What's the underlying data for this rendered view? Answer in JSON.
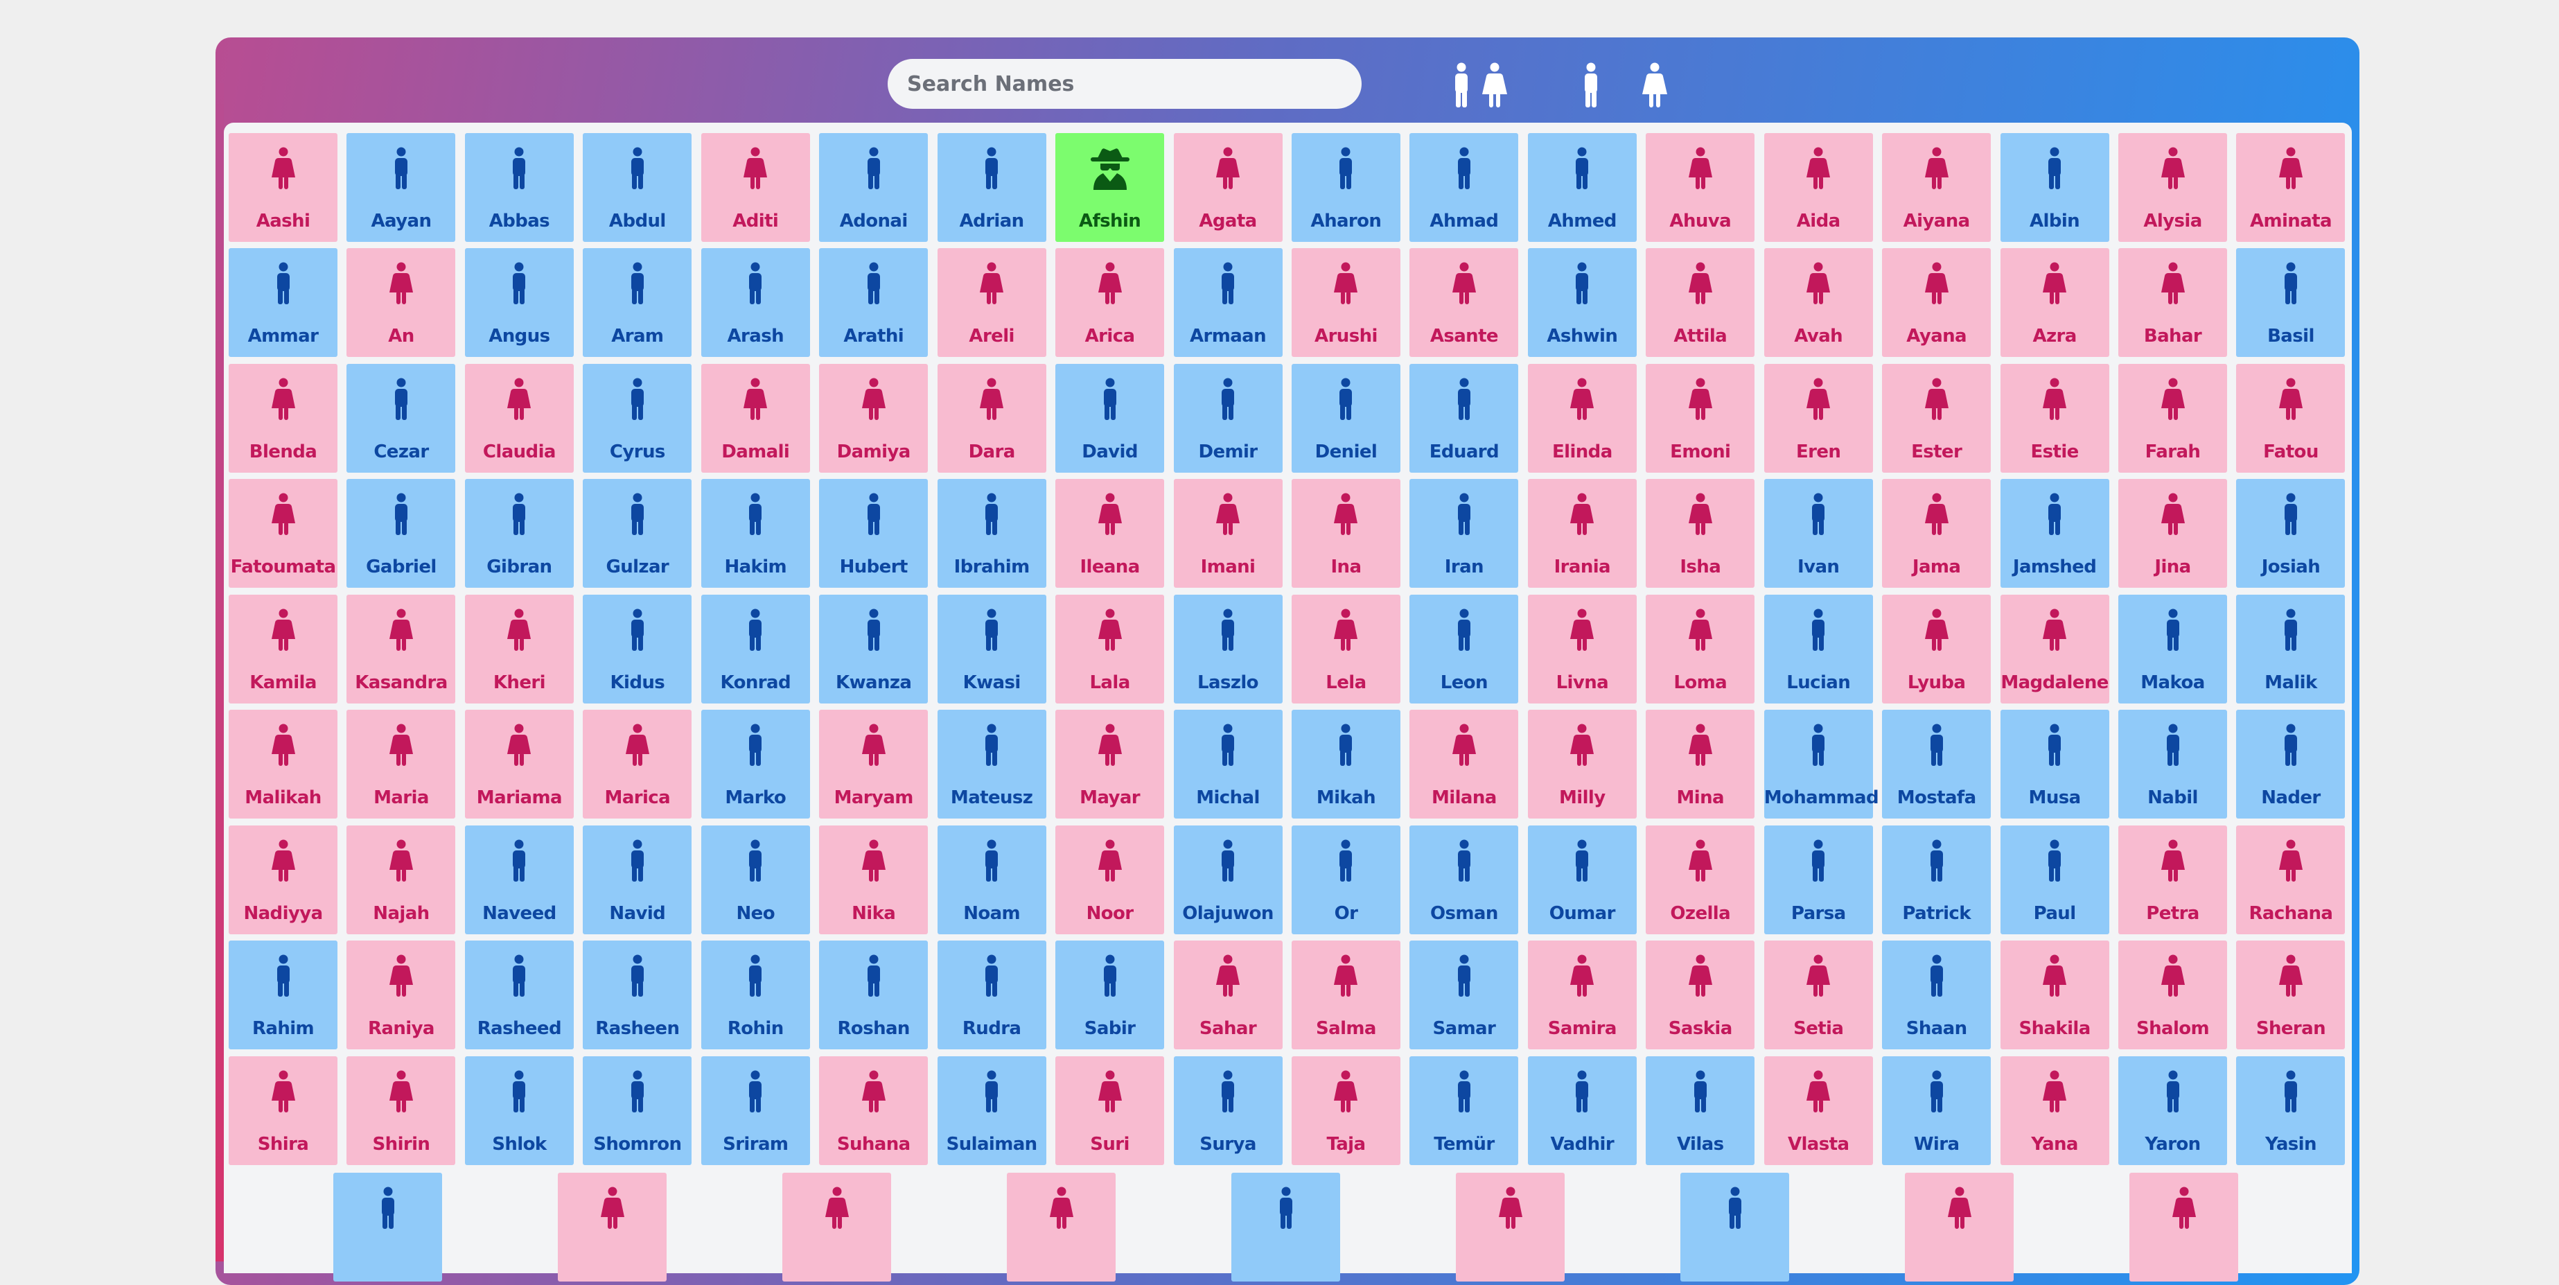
{
  "search": {
    "placeholder": "Search Names",
    "value": ""
  },
  "filters": [
    {
      "name": "filter-all-button",
      "icon": "man-and-woman-icon"
    },
    {
      "name": "filter-boys-button",
      "icon": "man-icon"
    },
    {
      "name": "filter-girls-button",
      "icon": "woman-icon"
    }
  ],
  "colors": {
    "boy_bg": "#90caf9",
    "boy_fg": "#0d47a1",
    "girl_bg": "#f8bbd0",
    "girl_fg": "#c2185b",
    "selected_bg": "#7cfc6e",
    "selected_fg": "#0b5a14",
    "header_gradient_start": "#b84d92",
    "header_gradient_end": "#2294f2"
  },
  "names": [
    {
      "n": "Aashi",
      "g": "f"
    },
    {
      "n": "Aayan",
      "g": "m"
    },
    {
      "n": "Abbas",
      "g": "m"
    },
    {
      "n": "Abdul",
      "g": "m"
    },
    {
      "n": "Aditi",
      "g": "f"
    },
    {
      "n": "Adonai",
      "g": "m"
    },
    {
      "n": "Adrian",
      "g": "m"
    },
    {
      "n": "Afshin",
      "g": "m",
      "selected": true,
      "icon": "spy-icon"
    },
    {
      "n": "Agata",
      "g": "f"
    },
    {
      "n": "Aharon",
      "g": "m"
    },
    {
      "n": "Ahmad",
      "g": "m"
    },
    {
      "n": "Ahmed",
      "g": "m"
    },
    {
      "n": "Ahuva",
      "g": "f"
    },
    {
      "n": "Aida",
      "g": "f"
    },
    {
      "n": "Aiyana",
      "g": "f"
    },
    {
      "n": "Albin",
      "g": "m"
    },
    {
      "n": "Alysia",
      "g": "f"
    },
    {
      "n": "Aminata",
      "g": "f"
    },
    {
      "n": "Ammar",
      "g": "m"
    },
    {
      "n": "An",
      "g": "f"
    },
    {
      "n": "Angus",
      "g": "m"
    },
    {
      "n": "Aram",
      "g": "m"
    },
    {
      "n": "Arash",
      "g": "m"
    },
    {
      "n": "Arathi",
      "g": "m"
    },
    {
      "n": "Areli",
      "g": "f"
    },
    {
      "n": "Arica",
      "g": "f"
    },
    {
      "n": "Armaan",
      "g": "m"
    },
    {
      "n": "Arushi",
      "g": "f"
    },
    {
      "n": "Asante",
      "g": "f"
    },
    {
      "n": "Ashwin",
      "g": "m"
    },
    {
      "n": "Attila",
      "g": "f"
    },
    {
      "n": "Avah",
      "g": "f"
    },
    {
      "n": "Ayana",
      "g": "f"
    },
    {
      "n": "Azra",
      "g": "f"
    },
    {
      "n": "Bahar",
      "g": "f"
    },
    {
      "n": "Basil",
      "g": "m"
    },
    {
      "n": "Blenda",
      "g": "f"
    },
    {
      "n": "Cezar",
      "g": "m"
    },
    {
      "n": "Claudia",
      "g": "f"
    },
    {
      "n": "Cyrus",
      "g": "m"
    },
    {
      "n": "Damali",
      "g": "f"
    },
    {
      "n": "Damiya",
      "g": "f"
    },
    {
      "n": "Dara",
      "g": "f"
    },
    {
      "n": "David",
      "g": "m"
    },
    {
      "n": "Demir",
      "g": "m"
    },
    {
      "n": "Deniel",
      "g": "m"
    },
    {
      "n": "Eduard",
      "g": "m"
    },
    {
      "n": "Elinda",
      "g": "f"
    },
    {
      "n": "Emoni",
      "g": "f"
    },
    {
      "n": "Eren",
      "g": "f"
    },
    {
      "n": "Ester",
      "g": "f"
    },
    {
      "n": "Estie",
      "g": "f"
    },
    {
      "n": "Farah",
      "g": "f"
    },
    {
      "n": "Fatou",
      "g": "f"
    },
    {
      "n": "Fatoumata",
      "g": "f"
    },
    {
      "n": "Gabriel",
      "g": "m"
    },
    {
      "n": "Gibran",
      "g": "m"
    },
    {
      "n": "Gulzar",
      "g": "m"
    },
    {
      "n": "Hakim",
      "g": "m"
    },
    {
      "n": "Hubert",
      "g": "m"
    },
    {
      "n": "Ibrahim",
      "g": "m"
    },
    {
      "n": "Ileana",
      "g": "f"
    },
    {
      "n": "Imani",
      "g": "f"
    },
    {
      "n": "Ina",
      "g": "f"
    },
    {
      "n": "Iran",
      "g": "m"
    },
    {
      "n": "Irania",
      "g": "f"
    },
    {
      "n": "Isha",
      "g": "f"
    },
    {
      "n": "Ivan",
      "g": "m"
    },
    {
      "n": "Jama",
      "g": "f"
    },
    {
      "n": "Jamshed",
      "g": "m"
    },
    {
      "n": "Jina",
      "g": "f"
    },
    {
      "n": "Josiah",
      "g": "m"
    },
    {
      "n": "Kamila",
      "g": "f"
    },
    {
      "n": "Kasandra",
      "g": "f"
    },
    {
      "n": "Kheri",
      "g": "f"
    },
    {
      "n": "Kidus",
      "g": "m"
    },
    {
      "n": "Konrad",
      "g": "m"
    },
    {
      "n": "Kwanza",
      "g": "m"
    },
    {
      "n": "Kwasi",
      "g": "m"
    },
    {
      "n": "Lala",
      "g": "f"
    },
    {
      "n": "Laszlo",
      "g": "m"
    },
    {
      "n": "Lela",
      "g": "f"
    },
    {
      "n": "Leon",
      "g": "m"
    },
    {
      "n": "Livna",
      "g": "f"
    },
    {
      "n": "Loma",
      "g": "f"
    },
    {
      "n": "Lucian",
      "g": "m"
    },
    {
      "n": "Lyuba",
      "g": "f"
    },
    {
      "n": "Magdalene",
      "g": "f"
    },
    {
      "n": "Makoa",
      "g": "m"
    },
    {
      "n": "Malik",
      "g": "m"
    },
    {
      "n": "Malikah",
      "g": "f"
    },
    {
      "n": "Maria",
      "g": "f"
    },
    {
      "n": "Mariama",
      "g": "f"
    },
    {
      "n": "Marica",
      "g": "f"
    },
    {
      "n": "Marko",
      "g": "m"
    },
    {
      "n": "Maryam",
      "g": "f"
    },
    {
      "n": "Mateusz",
      "g": "m"
    },
    {
      "n": "Mayar",
      "g": "f"
    },
    {
      "n": "Michal",
      "g": "m"
    },
    {
      "n": "Mikah",
      "g": "m"
    },
    {
      "n": "Milana",
      "g": "f"
    },
    {
      "n": "Milly",
      "g": "f"
    },
    {
      "n": "Mina",
      "g": "f"
    },
    {
      "n": "Mohammad",
      "g": "m"
    },
    {
      "n": "Mostafa",
      "g": "m"
    },
    {
      "n": "Musa",
      "g": "m"
    },
    {
      "n": "Nabil",
      "g": "m"
    },
    {
      "n": "Nader",
      "g": "m"
    },
    {
      "n": "Nadiyya",
      "g": "f"
    },
    {
      "n": "Najah",
      "g": "f"
    },
    {
      "n": "Naveed",
      "g": "m"
    },
    {
      "n": "Navid",
      "g": "m"
    },
    {
      "n": "Neo",
      "g": "m"
    },
    {
      "n": "Nika",
      "g": "f"
    },
    {
      "n": "Noam",
      "g": "m"
    },
    {
      "n": "Noor",
      "g": "f"
    },
    {
      "n": "Olajuwon",
      "g": "m"
    },
    {
      "n": "Or",
      "g": "m"
    },
    {
      "n": "Osman",
      "g": "m"
    },
    {
      "n": "Oumar",
      "g": "m"
    },
    {
      "n": "Ozella",
      "g": "f"
    },
    {
      "n": "Parsa",
      "g": "m"
    },
    {
      "n": "Patrick",
      "g": "m"
    },
    {
      "n": "Paul",
      "g": "m"
    },
    {
      "n": "Petra",
      "g": "f"
    },
    {
      "n": "Rachana",
      "g": "f"
    },
    {
      "n": "Rahim",
      "g": "m"
    },
    {
      "n": "Raniya",
      "g": "f"
    },
    {
      "n": "Rasheed",
      "g": "m"
    },
    {
      "n": "Rasheen",
      "g": "m"
    },
    {
      "n": "Rohin",
      "g": "m"
    },
    {
      "n": "Roshan",
      "g": "m"
    },
    {
      "n": "Rudra",
      "g": "m"
    },
    {
      "n": "Sabir",
      "g": "m"
    },
    {
      "n": "Sahar",
      "g": "f"
    },
    {
      "n": "Salma",
      "g": "f"
    },
    {
      "n": "Samar",
      "g": "m"
    },
    {
      "n": "Samira",
      "g": "f"
    },
    {
      "n": "Saskia",
      "g": "f"
    },
    {
      "n": "Setia",
      "g": "f"
    },
    {
      "n": "Shaan",
      "g": "m"
    },
    {
      "n": "Shakila",
      "g": "f"
    },
    {
      "n": "Shalom",
      "g": "f"
    },
    {
      "n": "Sheran",
      "g": "f"
    },
    {
      "n": "Shira",
      "g": "f"
    },
    {
      "n": "Shirin",
      "g": "f"
    },
    {
      "n": "Shlok",
      "g": "m"
    },
    {
      "n": "Shomron",
      "g": "m"
    },
    {
      "n": "Sriram",
      "g": "m"
    },
    {
      "n": "Suhana",
      "g": "f"
    },
    {
      "n": "Sulaiman",
      "g": "m"
    },
    {
      "n": "Suri",
      "g": "f"
    },
    {
      "n": "Surya",
      "g": "m"
    },
    {
      "n": "Taja",
      "g": "f"
    },
    {
      "n": "Temür",
      "g": "m"
    },
    {
      "n": "Vadhir",
      "g": "m"
    },
    {
      "n": "Vilas",
      "g": "m"
    },
    {
      "n": "Vlasta",
      "g": "f"
    },
    {
      "n": "Wira",
      "g": "m"
    },
    {
      "n": "Yana",
      "g": "f"
    },
    {
      "n": "Yaron",
      "g": "m"
    },
    {
      "n": "Yasin",
      "g": "m"
    }
  ],
  "partial_row": [
    {
      "g": "m"
    },
    {
      "g": "f"
    },
    {
      "g": "f"
    },
    {
      "g": "f"
    },
    {
      "g": "m"
    },
    {
      "g": "f"
    },
    {
      "g": "m"
    },
    {
      "g": "f"
    },
    {
      "g": "f"
    }
  ]
}
